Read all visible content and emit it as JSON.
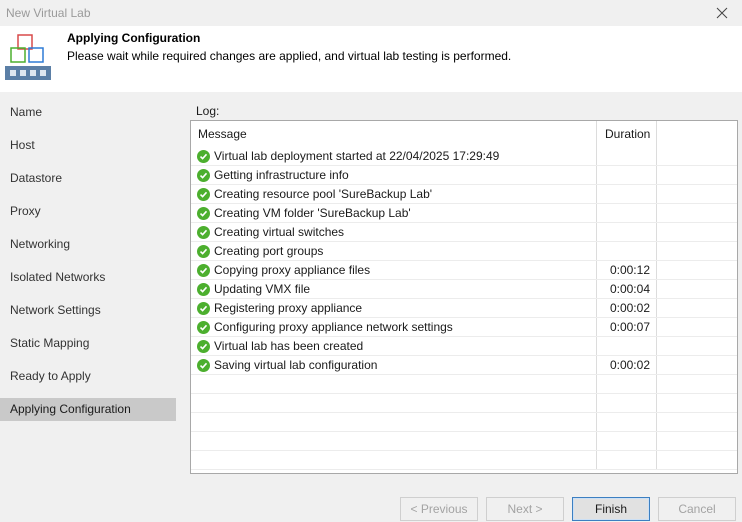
{
  "window": {
    "title": "New Virtual Lab"
  },
  "header": {
    "title": "Applying Configuration",
    "subtitle": "Please wait while required changes are applied, and virtual lab testing is performed."
  },
  "sidebar": {
    "items": [
      {
        "label": "Name"
      },
      {
        "label": "Host"
      },
      {
        "label": "Datastore"
      },
      {
        "label": "Proxy"
      },
      {
        "label": "Networking"
      },
      {
        "label": "Isolated Networks"
      },
      {
        "label": "Network Settings"
      },
      {
        "label": "Static Mapping"
      },
      {
        "label": "Ready to Apply"
      },
      {
        "label": "Applying Configuration",
        "active": true
      }
    ]
  },
  "log": {
    "label": "Log:",
    "columns": {
      "message": "Message",
      "duration": "Duration"
    },
    "rows": [
      {
        "message": "Virtual lab deployment started at 22/04/2025 17:29:49",
        "duration": ""
      },
      {
        "message": "Getting infrastructure info",
        "duration": ""
      },
      {
        "message": "Creating resource pool 'SureBackup Lab'",
        "duration": ""
      },
      {
        "message": "Creating VM folder 'SureBackup Lab'",
        "duration": ""
      },
      {
        "message": "Creating virtual switches",
        "duration": ""
      },
      {
        "message": "Creating port groups",
        "duration": ""
      },
      {
        "message": "Copying proxy appliance files",
        "duration": "0:00:12"
      },
      {
        "message": "Updating VMX file",
        "duration": "0:00:04"
      },
      {
        "message": "Registering proxy appliance",
        "duration": "0:00:02"
      },
      {
        "message": "Configuring proxy appliance network settings",
        "duration": "0:00:07"
      },
      {
        "message": "Virtual lab has been created",
        "duration": ""
      },
      {
        "message": "Saving virtual lab configuration",
        "duration": "0:00:02"
      }
    ],
    "status_icon": "check-circle-icon",
    "status_color": "#4caf2e"
  },
  "footer": {
    "previous": "< Previous",
    "next": "Next >",
    "finish": "Finish",
    "cancel": "Cancel"
  }
}
